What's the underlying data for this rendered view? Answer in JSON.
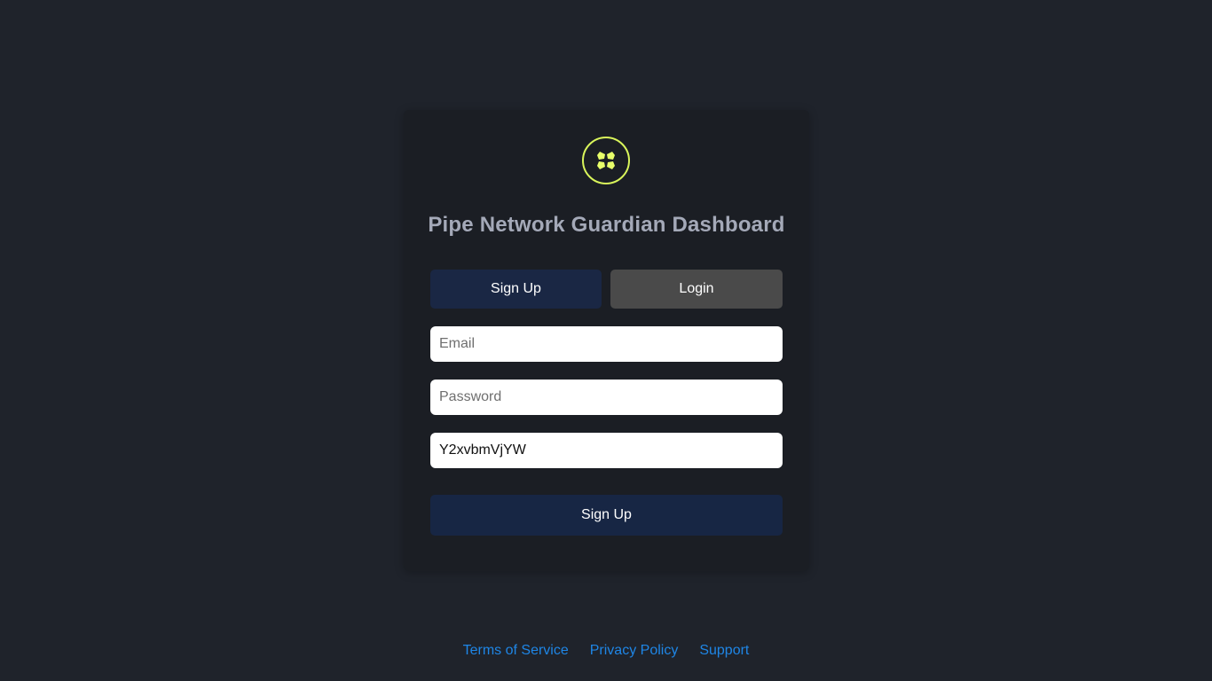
{
  "app": {
    "title": "Pipe Network Guardian Dashboard",
    "logo_icon": "pipe-network-logo-icon",
    "accent_color": "#d9f55b"
  },
  "tabs": {
    "signup_label": "Sign Up",
    "login_label": "Login"
  },
  "form": {
    "email_placeholder": "Email",
    "email_value": "",
    "password_placeholder": "Password",
    "password_value": "",
    "referral_value": "Y2xvbmVjYW",
    "submit_label": "Sign Up"
  },
  "footer": {
    "links": [
      "Terms of Service",
      "Privacy Policy",
      "Support"
    ]
  },
  "colors": {
    "background": "#1f232b",
    "card": "#1b1e24",
    "signup_tab": "#1a2744",
    "login_tab": "#4a4a4a",
    "submit": "#172644",
    "link": "#1f86e6"
  }
}
